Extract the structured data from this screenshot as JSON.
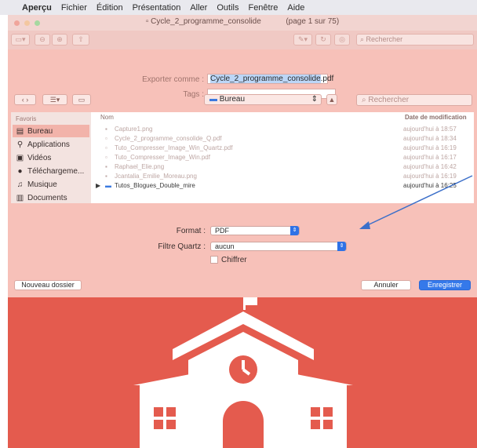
{
  "menubar": {
    "apple": "",
    "app_name": "Aperçu",
    "items": [
      "Fichier",
      "Édition",
      "Présentation",
      "Aller",
      "Outils",
      "Fenêtre",
      "Aide"
    ]
  },
  "window": {
    "title": "Cycle_2_programme_consolide",
    "page_info": "(page 1 sur 75)",
    "search_placeholder": "Rechercher"
  },
  "export": {
    "export_as_label": "Exporter comme :",
    "filename": "Cycle_2_programme_consolide",
    "extension": ".pdf",
    "tags_label": "Tags :"
  },
  "browser": {
    "location": "Bureau",
    "search_placeholder": "Rechercher",
    "sidebar_header": "Favoris",
    "sidebar_items": [
      "Bureau",
      "Applications",
      "Vidéos",
      "Téléchargeme...",
      "Musique",
      "Documents"
    ],
    "column_name": "Nom",
    "column_date": "Date de modification",
    "files": [
      {
        "name": "Capture1.png",
        "date": "aujourd'hui à 18:57"
      },
      {
        "name": "Cycle_2_programme_consolide_Q.pdf",
        "date": "aujourd'hui à 18:34"
      },
      {
        "name": "Tuto_Compresser_Image_Win_Quartz.pdf",
        "date": "aujourd'hui à 16:19"
      },
      {
        "name": "Tuto_Compresser_Image_Win.pdf",
        "date": "aujourd'hui à 16:17"
      },
      {
        "name": "Raphael_Elie.png",
        "date": "aujourd'hui à 16:42"
      },
      {
        "name": "Jcantalia_Emilie_Moreau.png",
        "date": "aujourd'hui à 16:19"
      },
      {
        "name": "Tutos_Blogues_Double_mire",
        "date": "aujourd'hui à 16:25"
      }
    ]
  },
  "options": {
    "format_label": "Format :",
    "format_value": "PDF",
    "quartz_label": "Filtre Quartz :",
    "quartz_value": "aucun",
    "encrypt_label": "Chiffrer"
  },
  "buttons": {
    "new_folder": "Nouveau dossier",
    "cancel": "Annuler",
    "save": "Enregistrer"
  },
  "colors": {
    "sheet": "#f7c1b9",
    "poster": "#e45b4e",
    "accent": "#3579ea",
    "arrow": "#3b6fc9"
  }
}
